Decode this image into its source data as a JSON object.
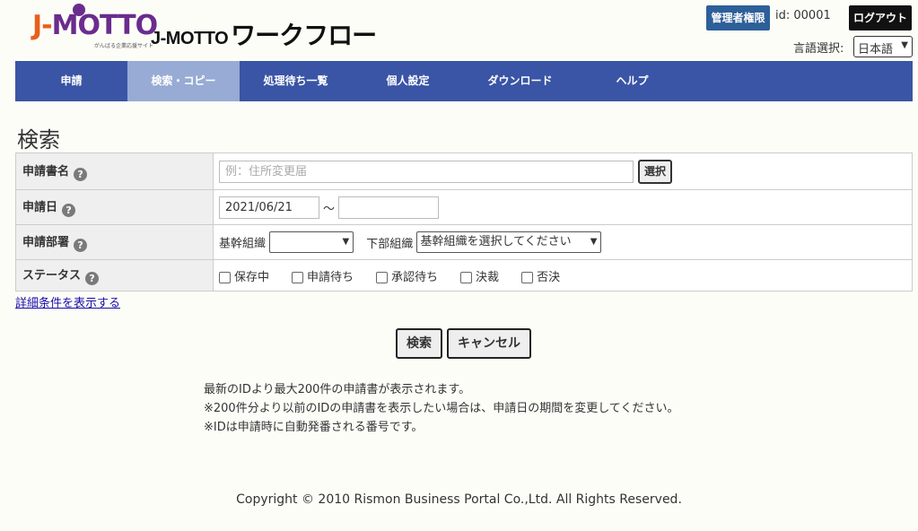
{
  "header": {
    "logo_text_j": "J-",
    "logo_text_rest": "MOTTO",
    "logo_tagline": "がんばる企業応援サイト",
    "brand_en": "J-MOTTO",
    "brand_ja": "ワークフロー",
    "admin_badge": "管理者権限",
    "user_id": "id: 00001",
    "logout_label": "ログアウト",
    "lang_label": "言語選択:",
    "lang_value": "日本語"
  },
  "nav": {
    "items": [
      {
        "label": "申請"
      },
      {
        "label": "検索・コピー"
      },
      {
        "label": "処理待ち一覧"
      },
      {
        "label": "個人設定"
      },
      {
        "label": "ダウンロード"
      },
      {
        "label": "ヘルプ"
      }
    ],
    "active": "検索・コピー"
  },
  "page": {
    "title": "検索"
  },
  "form": {
    "form_name": {
      "label": "申請書名",
      "placeholder": "例：住所変更届",
      "select_label": "選択"
    },
    "date": {
      "label": "申請日",
      "from_value": "2021/06/21",
      "separator": "〜",
      "to_value": ""
    },
    "dept": {
      "label": "申請部署",
      "main_label": "基幹組織",
      "main_value": "",
      "sub_label": "下部組織",
      "sub_value": "基幹組織を選択してください"
    },
    "status": {
      "label": "ステータス",
      "options": [
        {
          "label": "保存中",
          "checked": false
        },
        {
          "label": "申請待ち",
          "checked": false
        },
        {
          "label": "承認待ち",
          "checked": false
        },
        {
          "label": "決裁",
          "checked": false
        },
        {
          "label": "否決",
          "checked": false
        }
      ]
    },
    "help_mark": "?"
  },
  "detail_link": "詳細条件を表示する",
  "buttons": {
    "search": "検索",
    "cancel": "キャンセル"
  },
  "notes": [
    "最新のIDより最大200件の申請書が表示されます。",
    "※200件分より以前のIDの申請書を表示したい場合は、申請日の期間を変更してください。",
    "※IDは申請時に自動発番される番号です。"
  ],
  "footer": "Copyright © 2010 Rismon Business Portal Co.,Ltd. All Rights Reserved."
}
